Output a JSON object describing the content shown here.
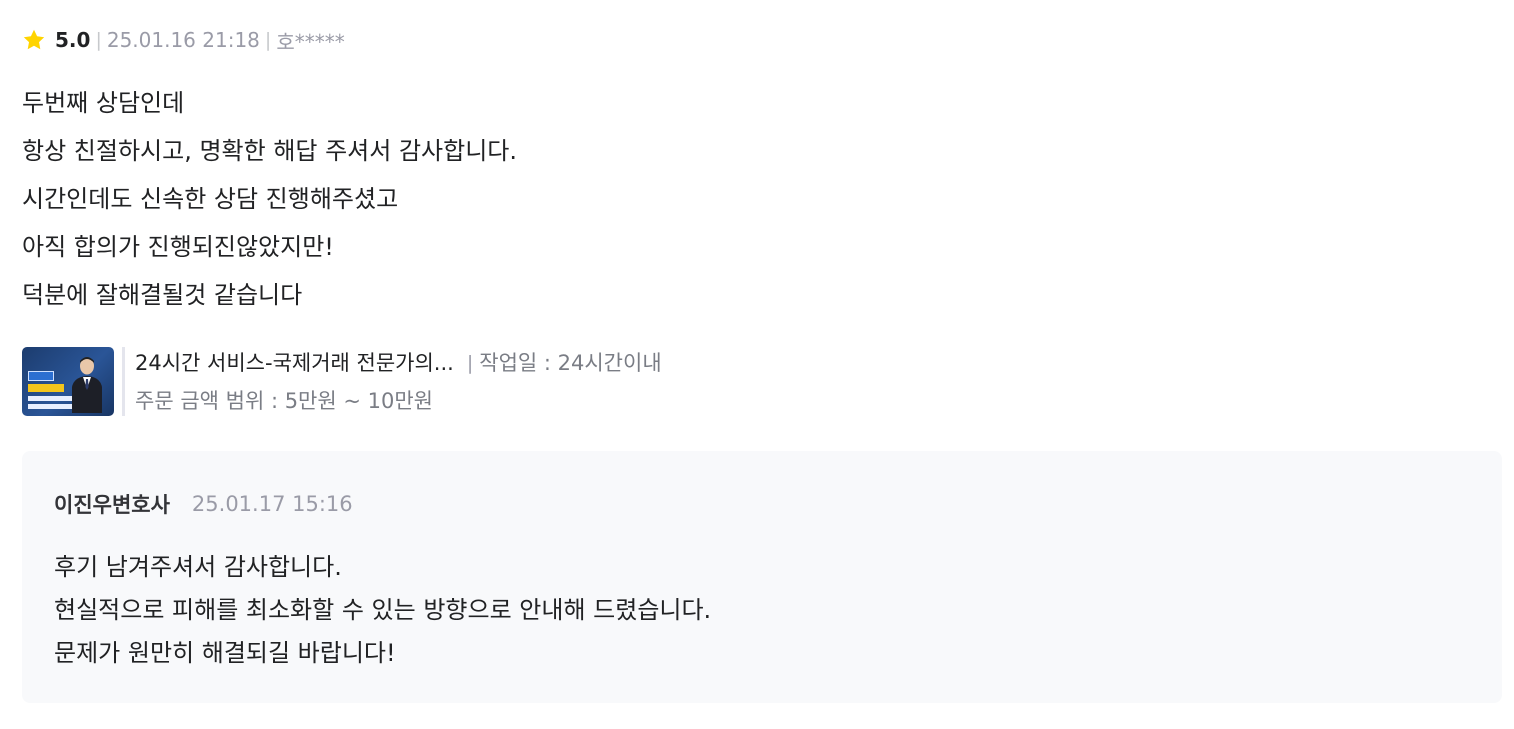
{
  "review": {
    "rating": "5.0",
    "date": "25.01.16 21:18",
    "author": "호*****",
    "separator": "|",
    "star_icon_color": "#FFD400",
    "body": [
      "두번째 상담인데",
      "항상 친절하시고, 명확한 해답 주셔서 감사합니다.",
      "시간인데도 신속한 상담 진행해주셨고",
      "아직 합의가 진행되진않았지만!",
      "덕분에 잘해결될것 같습니다"
    ]
  },
  "product": {
    "title": "24시간 서비스-국제거래 전문가의...",
    "separator": "|",
    "work_period": "작업일 : 24시간이내",
    "price_range": "주문 금액 범위 : 5만원 ~ 10만원",
    "thumbnail_icon": "lawyer-service-thumbnail"
  },
  "reply": {
    "seller": "이진우변호사",
    "date": "25.01.17 15:16",
    "body": [
      "후기 남겨주셔서 감사합니다.",
      "현실적으로 피해를 최소화할 수 있는 방향으로 안내해 드렸습니다.",
      "문제가 원만히 해결되길 바랍니다!"
    ]
  }
}
